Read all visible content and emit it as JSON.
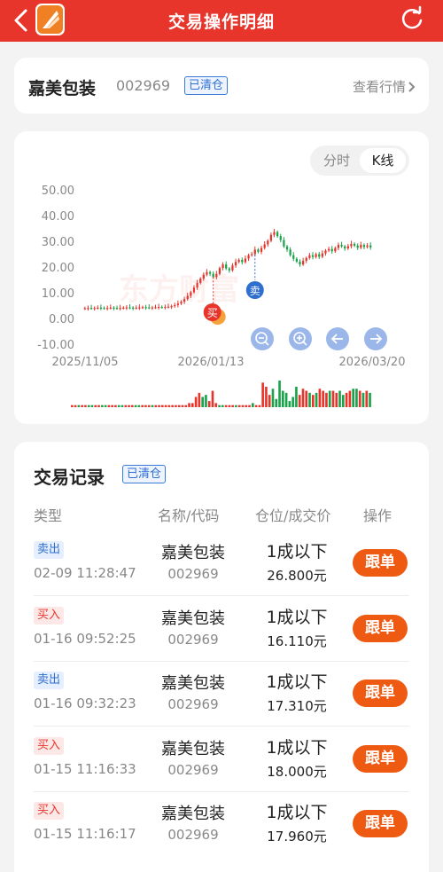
{
  "header": {
    "title": "交易操作明细",
    "icons": {
      "back": "chevron-left-icon",
      "logo": "app-logo",
      "refresh": "refresh-icon"
    }
  },
  "stock": {
    "name": "嘉美包装",
    "code": "002969",
    "status": "已清仓",
    "link": "查看行情"
  },
  "chart": {
    "tabs": [
      {
        "label": "分时",
        "active": false
      },
      {
        "label": "K线",
        "active": true
      }
    ],
    "watermark": "东方财富",
    "buy_marker": "买",
    "sell_marker": "卖",
    "controls": [
      "zoom-out-icon",
      "zoom-in-icon",
      "arrow-left-icon",
      "arrow-right-icon"
    ]
  },
  "chart_data": {
    "type": "candlestick",
    "y_ticks": [
      "50.00",
      "40.00",
      "30.00",
      "20.00",
      "10.00",
      "0.00",
      "-10.00"
    ],
    "ylim": [
      -10,
      50
    ],
    "x_ticks": [
      "2025/11/05",
      "2026/01/13",
      "2026/03/20"
    ],
    "colors": {
      "up": "#e8352c",
      "down": "#1aa34a"
    },
    "close_prices": [
      4.0,
      4.1,
      4.0,
      4.1,
      4.2,
      4.1,
      4.0,
      4.1,
      4.2,
      4.1,
      4.0,
      4.1,
      4.2,
      4.3,
      4.2,
      4.1,
      4.2,
      4.3,
      4.4,
      4.3,
      4.2,
      4.3,
      4.4,
      4.5,
      4.4,
      4.5,
      4.6,
      4.8,
      5.2,
      5.8,
      6.5,
      7.5,
      8.8,
      10.2,
      12.0,
      13.8,
      15.5,
      17.0,
      18.0,
      17.4,
      16.1,
      17.3,
      19.6,
      21.0,
      19.4,
      18.7,
      20.6,
      22.0,
      22.8,
      21.9,
      23.3,
      24.6,
      25.0,
      26.8,
      25.9,
      27.4,
      28.8,
      30.2,
      32.5,
      33.6,
      32.0,
      30.5,
      28.0,
      26.8,
      24.6,
      23.2,
      22.1,
      21.0,
      22.4,
      23.5,
      24.6,
      23.9,
      25.0,
      24.0,
      25.3,
      26.4,
      27.0,
      26.1,
      27.4,
      28.6,
      28.0,
      27.2,
      28.1,
      29.0,
      28.3,
      27.5,
      28.6,
      27.8,
      28.4,
      27.6
    ],
    "volume": [
      1,
      1,
      1,
      1,
      1,
      1,
      1,
      1,
      1,
      1,
      1,
      1,
      1,
      1,
      1,
      1,
      1,
      1,
      1,
      1,
      1,
      1,
      1,
      1,
      1,
      1,
      1,
      1,
      1,
      1,
      1,
      1,
      1,
      1,
      1,
      2,
      2,
      5,
      7,
      5,
      6,
      3,
      8,
      2,
      1,
      1,
      1,
      1,
      1,
      1,
      1,
      1,
      1,
      1,
      2,
      1,
      1,
      12,
      10,
      6,
      9,
      4,
      13,
      8,
      7,
      3,
      5,
      10,
      6,
      9,
      8,
      7,
      6,
      7,
      9,
      8,
      7,
      8,
      8,
      7,
      8,
      6,
      7,
      8,
      9,
      9,
      8,
      7,
      8,
      7
    ],
    "volume_colors": [
      "up",
      "down"
    ]
  },
  "trades": {
    "title": "交易记录",
    "status": "已清仓",
    "columns": [
      "类型",
      "名称/代码",
      "仓位/成交价",
      "操作"
    ],
    "rows": [
      {
        "type": "卖出",
        "side": "sell",
        "time": "02-09 11:28:47",
        "name": "嘉美包装",
        "code": "002969",
        "position": "1成以下",
        "price": "26.800元",
        "action": "跟单"
      },
      {
        "type": "买入",
        "side": "buy",
        "time": "01-16 09:52:25",
        "name": "嘉美包装",
        "code": "002969",
        "position": "1成以下",
        "price": "16.110元",
        "action": "跟单"
      },
      {
        "type": "卖出",
        "side": "sell",
        "time": "01-16 09:32:23",
        "name": "嘉美包装",
        "code": "002969",
        "position": "1成以下",
        "price": "17.310元",
        "action": "跟单"
      },
      {
        "type": "买入",
        "side": "buy",
        "time": "01-15 11:16:33",
        "name": "嘉美包装",
        "code": "002969",
        "position": "1成以下",
        "price": "18.000元",
        "action": "跟单"
      },
      {
        "type": "买入",
        "side": "buy",
        "time": "01-15 11:16:17",
        "name": "嘉美包装",
        "code": "002969",
        "position": "1成以下",
        "price": "17.960元",
        "action": "跟单"
      }
    ]
  }
}
